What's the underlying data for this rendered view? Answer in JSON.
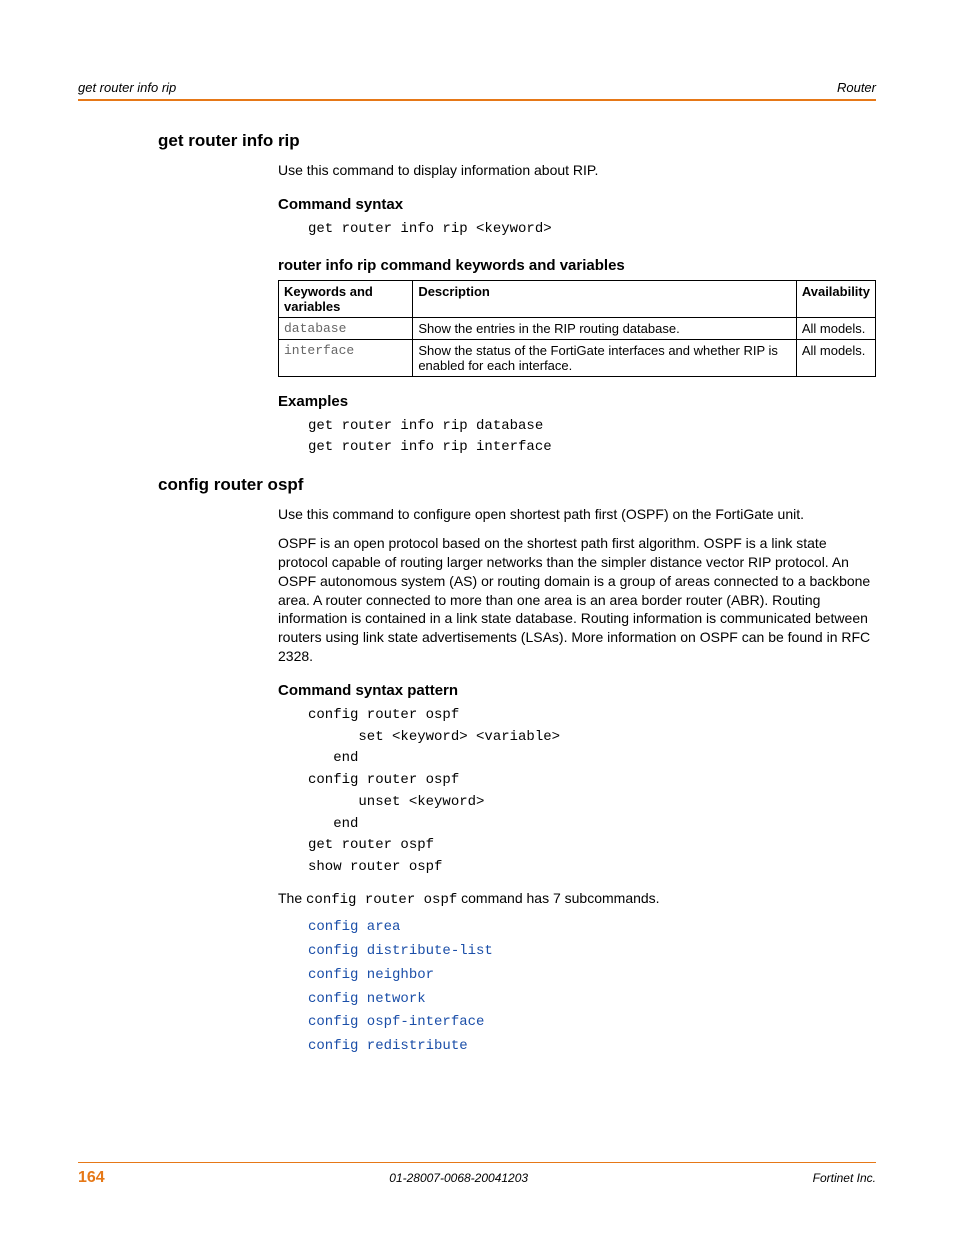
{
  "header": {
    "left": "get router info rip",
    "right": "Router"
  },
  "s1": {
    "title": "get router info rip",
    "intro": "Use this command to display information about RIP.",
    "syntax_h": "Command syntax",
    "syntax_code": "get router info rip <keyword>",
    "table_h": "router info rip command keywords and variables",
    "th1": "Keywords and variables",
    "th2": "Description",
    "th3": "Availability",
    "r1c1": "database",
    "r1c2": "Show the entries in the RIP routing database.",
    "r1c3": "All models.",
    "r2c1": "interface",
    "r2c2": "Show the status of the FortiGate interfaces and whether RIP is enabled for each interface.",
    "r2c3": "All models.",
    "examples_h": "Examples",
    "ex1": "get router info rip database",
    "ex2": "get router info rip interface"
  },
  "s2": {
    "title": "config router ospf",
    "intro": "Use this command to configure open shortest path first (OSPF) on the FortiGate unit.",
    "para": "OSPF is an open protocol based on the shortest path first algorithm. OSPF is a link state protocol capable of routing larger networks than the simpler distance vector RIP protocol. An OSPF autonomous system (AS) or routing domain is a group of areas connected to a backbone area. A router connected to more than one area is an area border router (ABR). Routing information is contained in a link state database. Routing information is communicated between routers using link state advertisements (LSAs). More information on OSPF can be found in RFC 2328.",
    "syntax_h": "Command syntax pattern",
    "code": "config router ospf\n      set <keyword> <variable>\n   end\nconfig router ospf\n      unset <keyword>\n   end\nget router ospf\nshow router ospf",
    "sub_pre": "The ",
    "sub_code": "config router ospf",
    "sub_post": " command has 7 subcommands.",
    "links": {
      "l1": "config area",
      "l2": "config distribute-list",
      "l3": "config neighbor",
      "l4": "config network",
      "l5": "config ospf-interface",
      "l6": "config redistribute"
    }
  },
  "footer": {
    "page": "164",
    "mid": "01-28007-0068-20041203",
    "right": "Fortinet Inc."
  }
}
